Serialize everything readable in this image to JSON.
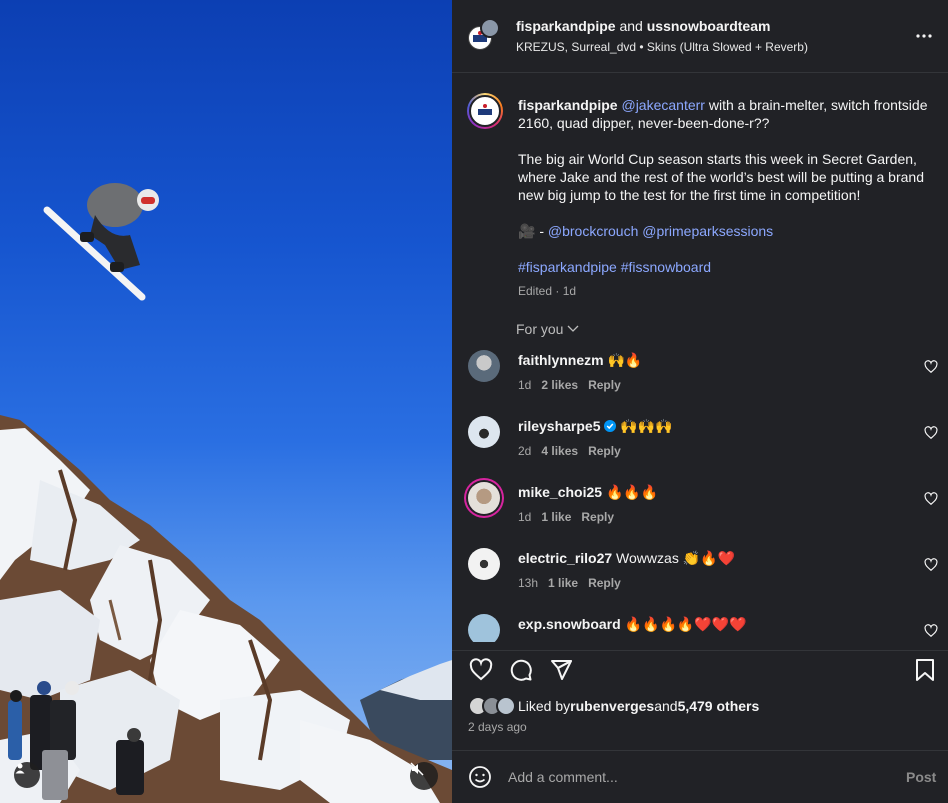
{
  "header": {
    "user1": "fisparkandpipe",
    "and": " and ",
    "user2": "ussnowboardteam",
    "audio": "KREZUS, Surreal_dvd • Skins (Ultra Slowed + Reverb)"
  },
  "caption": {
    "username": "fisparkandpipe",
    "mention": "@jakecanterr",
    "text1": " with a brain-melter, switch frontside 2160, quad dipper, never-been-done-r??",
    "paragraph2": "The big air World Cup season starts this week in Secret Garden, where Jake and the rest of the world’s best will be putting a brand new big jump to the test for the first time in competition!",
    "camera": "🎥",
    "dash": " - ",
    "credit1": "@brockcrouch",
    "credit2": "@primeparksessions",
    "hashtags": "#fisparkandpipe #fissnowboard",
    "meta": "Edited · 1d"
  },
  "for_you": "For you",
  "comments": [
    {
      "user": "faithlynnezm",
      "text": " 🙌🔥",
      "time": "1d",
      "likes": "2 likes",
      "reply": "Reply",
      "verified": false
    },
    {
      "user": "rileysharpe5",
      "text": " 🙌🙌🙌",
      "time": "2d",
      "likes": "4 likes",
      "reply": "Reply",
      "verified": true
    },
    {
      "user": "mike_choi25",
      "text": " 🔥🔥🔥",
      "time": "1d",
      "likes": "1 like",
      "reply": "Reply",
      "verified": false
    },
    {
      "user": "electric_rilo27",
      "text": " Wowwzas 👏🔥❤️",
      "time": "13h",
      "likes": "1 like",
      "reply": "Reply",
      "verified": false
    },
    {
      "user": "exp.snowboard",
      "text": " 🔥🔥🔥🔥❤️❤️❤️",
      "time": "",
      "likes": "",
      "reply": "",
      "verified": false
    }
  ],
  "likes": {
    "prefix": "Liked by ",
    "user": "rubenverges",
    "mid": " and ",
    "count": "5,479 others"
  },
  "posted": "2 days ago",
  "add_comment": {
    "placeholder": "Add a comment...",
    "post_label": "Post"
  },
  "icons": [
    "more-icon",
    "chevron-down-icon",
    "heart-icon",
    "comment-icon",
    "share-icon",
    "bookmark-icon",
    "emoji-icon",
    "user-tag-icon",
    "muted-icon",
    "verified-icon"
  ],
  "colors": {
    "link": "#8ca8ff",
    "panel_bg": "#212226",
    "verified": "#0095f6"
  }
}
